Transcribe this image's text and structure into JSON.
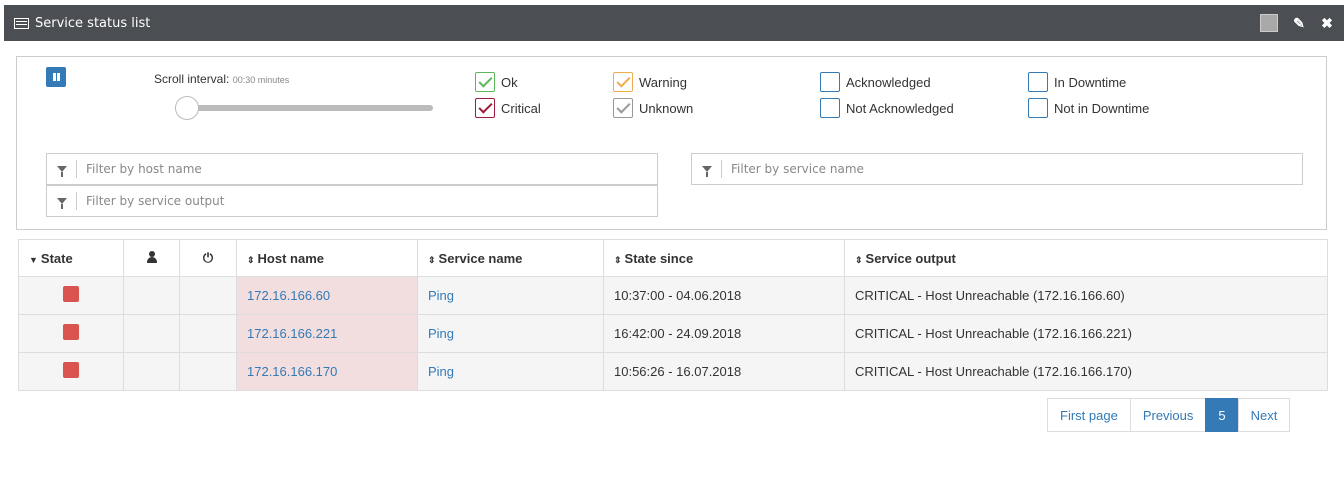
{
  "window": {
    "title": "Service status list"
  },
  "filters": {
    "scroll_interval_label": "Scroll interval:",
    "scroll_interval_value": "00:30 minutes",
    "slider_level": 0,
    "checkboxes": {
      "ok": {
        "label": "Ok",
        "checked": true
      },
      "critical": {
        "label": "Critical",
        "checked": true
      },
      "warning": {
        "label": "Warning",
        "checked": true
      },
      "unknown": {
        "label": "Unknown",
        "checked": true
      },
      "acknowledged": {
        "label": "Acknowledged",
        "checked": false
      },
      "not_acknowledged": {
        "label": "Not Acknowledged",
        "checked": false
      },
      "in_downtime": {
        "label": "In Downtime",
        "checked": false
      },
      "not_in_downtime": {
        "label": "Not in Downtime",
        "checked": false
      }
    },
    "host_name_placeholder": "Filter by host name",
    "service_output_placeholder": "Filter by service output",
    "service_name_placeholder": "Filter by service name"
  },
  "table": {
    "headers": {
      "state": "State",
      "host_name": "Host name",
      "service_name": "Service name",
      "state_since": "State since",
      "service_output": "Service output"
    },
    "rows": [
      {
        "host": "172.16.166.60",
        "service": "Ping",
        "since": "10:37:00 - 04.06.2018",
        "output": "CRITICAL - Host Unreachable (172.16.166.60)"
      },
      {
        "host": "172.16.166.221",
        "service": "Ping",
        "since": "16:42:00 - 24.09.2018",
        "output": "CRITICAL - Host Unreachable (172.16.166.221)"
      },
      {
        "host": "172.16.166.170",
        "service": "Ping",
        "since": "10:56:26 - 16.07.2018",
        "output": "CRITICAL - Host Unreachable (172.16.166.170)"
      }
    ]
  },
  "pagination": {
    "first": "First page",
    "previous": "Previous",
    "current": "5",
    "next": "Next"
  },
  "colors": {
    "titlebar": "#4b4e52",
    "accent": "#337ab7",
    "critical": "#d9534f",
    "host_cell": "#f2dede"
  }
}
